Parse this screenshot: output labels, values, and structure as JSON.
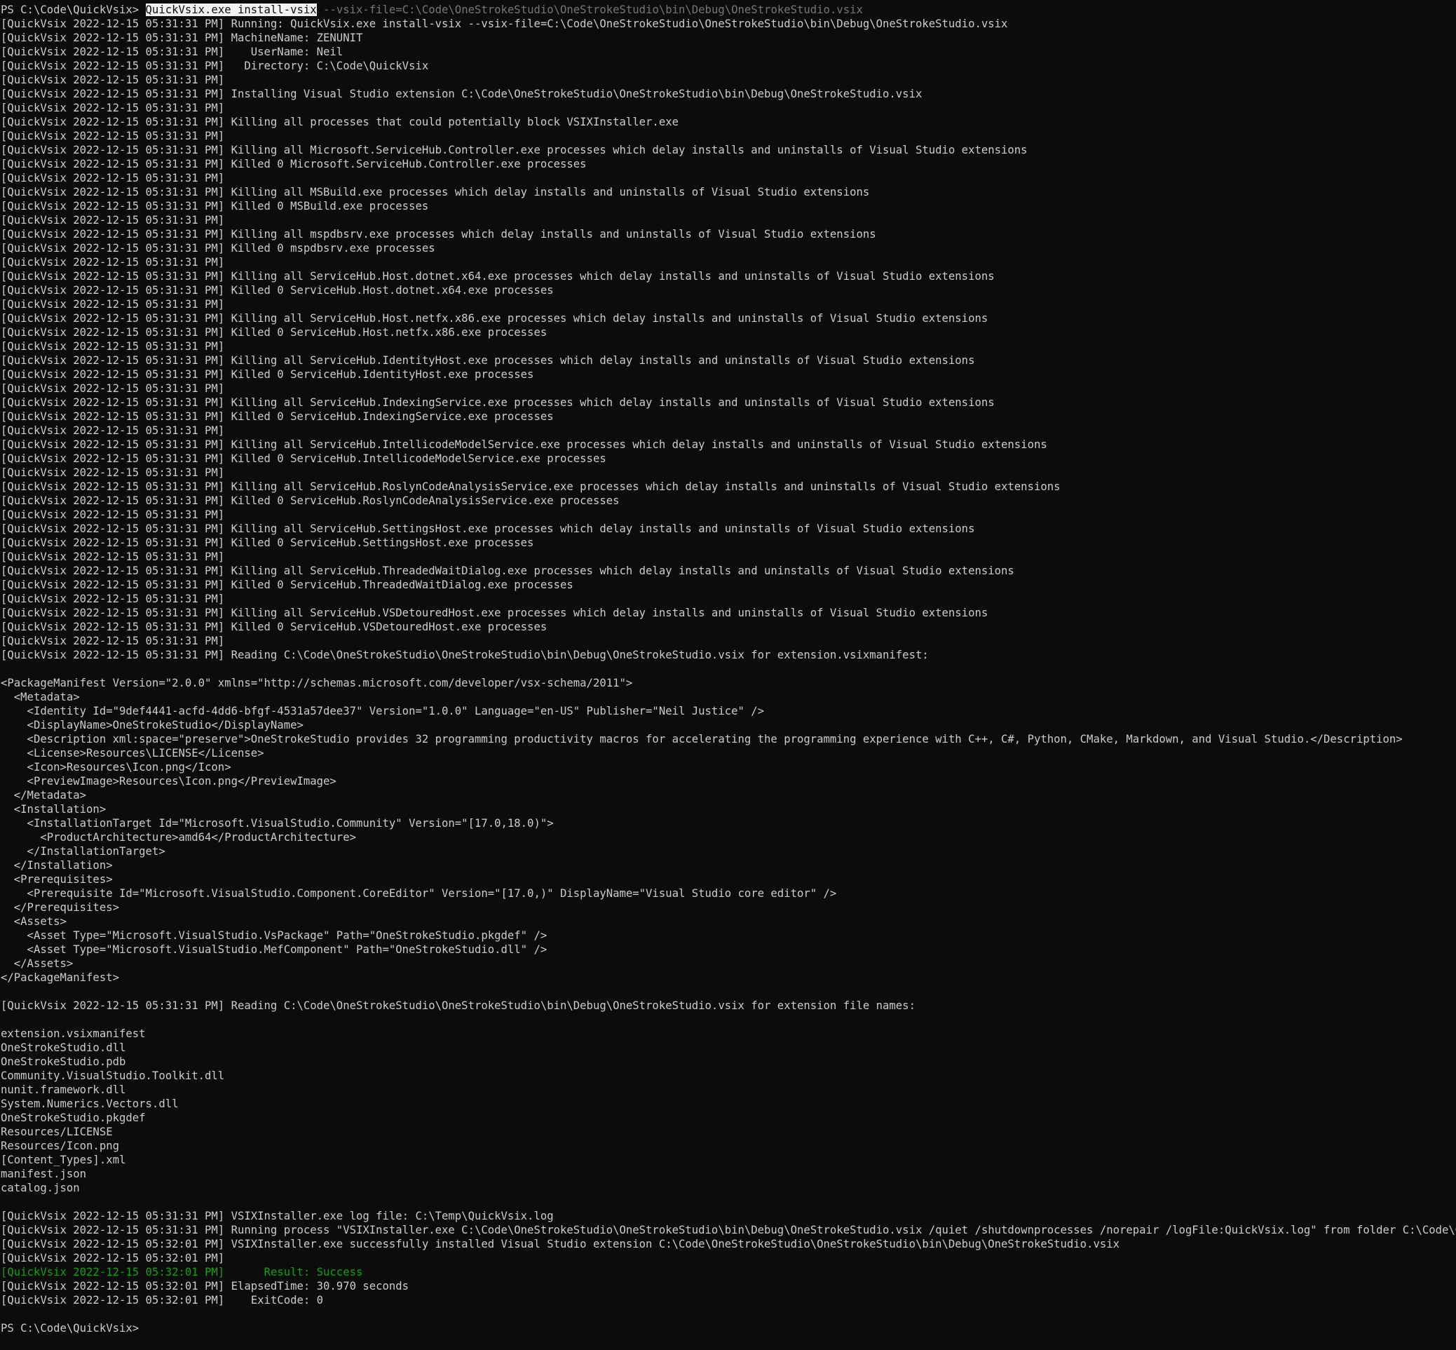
{
  "window": {
    "prompt_initial": "PS C:\\Code\\QuickVsix> ",
    "command_selected": "QuickVsix.exe install-vsix",
    "command_rest": " --vsix-file=C:\\Code\\OneStrokeStudio\\OneStrokeStudio\\bin\\Debug\\OneStrokeStudio.vsix",
    "prompt_final": "PS C:\\Code\\QuickVsix> "
  },
  "colors": {
    "background": "#0c0c0c",
    "foreground": "#cccccc",
    "selection_bg": "#f2f2f2",
    "suggestion": "#767676",
    "success": "#13a10e"
  },
  "lines": [
    {
      "text": "[QuickVsix 2022-12-15 05:31:31 PM] Running: QuickVsix.exe install-vsix --vsix-file=C:\\Code\\OneStrokeStudio\\OneStrokeStudio\\bin\\Debug\\OneStrokeStudio.vsix"
    },
    {
      "text": "[QuickVsix 2022-12-15 05:31:31 PM] MachineName: ZENUNIT"
    },
    {
      "text": "[QuickVsix 2022-12-15 05:31:31 PM]    UserName: Neil"
    },
    {
      "text": "[QuickVsix 2022-12-15 05:31:31 PM]   Directory: C:\\Code\\QuickVsix"
    },
    {
      "text": "[QuickVsix 2022-12-15 05:31:31 PM]"
    },
    {
      "text": "[QuickVsix 2022-12-15 05:31:31 PM] Installing Visual Studio extension C:\\Code\\OneStrokeStudio\\OneStrokeStudio\\bin\\Debug\\OneStrokeStudio.vsix"
    },
    {
      "text": "[QuickVsix 2022-12-15 05:31:31 PM]"
    },
    {
      "text": "[QuickVsix 2022-12-15 05:31:31 PM] Killing all processes that could potentially block VSIXInstaller.exe"
    },
    {
      "text": "[QuickVsix 2022-12-15 05:31:31 PM]"
    },
    {
      "text": "[QuickVsix 2022-12-15 05:31:31 PM] Killing all Microsoft.ServiceHub.Controller.exe processes which delay installs and uninstalls of Visual Studio extensions"
    },
    {
      "text": "[QuickVsix 2022-12-15 05:31:31 PM] Killed 0 Microsoft.ServiceHub.Controller.exe processes"
    },
    {
      "text": "[QuickVsix 2022-12-15 05:31:31 PM]"
    },
    {
      "text": "[QuickVsix 2022-12-15 05:31:31 PM] Killing all MSBuild.exe processes which delay installs and uninstalls of Visual Studio extensions"
    },
    {
      "text": "[QuickVsix 2022-12-15 05:31:31 PM] Killed 0 MSBuild.exe processes"
    },
    {
      "text": "[QuickVsix 2022-12-15 05:31:31 PM]"
    },
    {
      "text": "[QuickVsix 2022-12-15 05:31:31 PM] Killing all mspdbsrv.exe processes which delay installs and uninstalls of Visual Studio extensions"
    },
    {
      "text": "[QuickVsix 2022-12-15 05:31:31 PM] Killed 0 mspdbsrv.exe processes"
    },
    {
      "text": "[QuickVsix 2022-12-15 05:31:31 PM]"
    },
    {
      "text": "[QuickVsix 2022-12-15 05:31:31 PM] Killing all ServiceHub.Host.dotnet.x64.exe processes which delay installs and uninstalls of Visual Studio extensions"
    },
    {
      "text": "[QuickVsix 2022-12-15 05:31:31 PM] Killed 0 ServiceHub.Host.dotnet.x64.exe processes"
    },
    {
      "text": "[QuickVsix 2022-12-15 05:31:31 PM]"
    },
    {
      "text": "[QuickVsix 2022-12-15 05:31:31 PM] Killing all ServiceHub.Host.netfx.x86.exe processes which delay installs and uninstalls of Visual Studio extensions"
    },
    {
      "text": "[QuickVsix 2022-12-15 05:31:31 PM] Killed 0 ServiceHub.Host.netfx.x86.exe processes"
    },
    {
      "text": "[QuickVsix 2022-12-15 05:31:31 PM]"
    },
    {
      "text": "[QuickVsix 2022-12-15 05:31:31 PM] Killing all ServiceHub.IdentityHost.exe processes which delay installs and uninstalls of Visual Studio extensions"
    },
    {
      "text": "[QuickVsix 2022-12-15 05:31:31 PM] Killed 0 ServiceHub.IdentityHost.exe processes"
    },
    {
      "text": "[QuickVsix 2022-12-15 05:31:31 PM]"
    },
    {
      "text": "[QuickVsix 2022-12-15 05:31:31 PM] Killing all ServiceHub.IndexingService.exe processes which delay installs and uninstalls of Visual Studio extensions"
    },
    {
      "text": "[QuickVsix 2022-12-15 05:31:31 PM] Killed 0 ServiceHub.IndexingService.exe processes"
    },
    {
      "text": "[QuickVsix 2022-12-15 05:31:31 PM]"
    },
    {
      "text": "[QuickVsix 2022-12-15 05:31:31 PM] Killing all ServiceHub.IntellicodeModelService.exe processes which delay installs and uninstalls of Visual Studio extensions"
    },
    {
      "text": "[QuickVsix 2022-12-15 05:31:31 PM] Killed 0 ServiceHub.IntellicodeModelService.exe processes"
    },
    {
      "text": "[QuickVsix 2022-12-15 05:31:31 PM]"
    },
    {
      "text": "[QuickVsix 2022-12-15 05:31:31 PM] Killing all ServiceHub.RoslynCodeAnalysisService.exe processes which delay installs and uninstalls of Visual Studio extensions"
    },
    {
      "text": "[QuickVsix 2022-12-15 05:31:31 PM] Killed 0 ServiceHub.RoslynCodeAnalysisService.exe processes"
    },
    {
      "text": "[QuickVsix 2022-12-15 05:31:31 PM]"
    },
    {
      "text": "[QuickVsix 2022-12-15 05:31:31 PM] Killing all ServiceHub.SettingsHost.exe processes which delay installs and uninstalls of Visual Studio extensions"
    },
    {
      "text": "[QuickVsix 2022-12-15 05:31:31 PM] Killed 0 ServiceHub.SettingsHost.exe processes"
    },
    {
      "text": "[QuickVsix 2022-12-15 05:31:31 PM]"
    },
    {
      "text": "[QuickVsix 2022-12-15 05:31:31 PM] Killing all ServiceHub.ThreadedWaitDialog.exe processes which delay installs and uninstalls of Visual Studio extensions"
    },
    {
      "text": "[QuickVsix 2022-12-15 05:31:31 PM] Killed 0 ServiceHub.ThreadedWaitDialog.exe processes"
    },
    {
      "text": "[QuickVsix 2022-12-15 05:31:31 PM]"
    },
    {
      "text": "[QuickVsix 2022-12-15 05:31:31 PM] Killing all ServiceHub.VSDetouredHost.exe processes which delay installs and uninstalls of Visual Studio extensions"
    },
    {
      "text": "[QuickVsix 2022-12-15 05:31:31 PM] Killed 0 ServiceHub.VSDetouredHost.exe processes"
    },
    {
      "text": "[QuickVsix 2022-12-15 05:31:31 PM]"
    },
    {
      "text": "[QuickVsix 2022-12-15 05:31:31 PM] Reading C:\\Code\\OneStrokeStudio\\OneStrokeStudio\\bin\\Debug\\OneStrokeStudio.vsix for extension.vsixmanifest:"
    },
    {
      "text": ""
    },
    {
      "text": "<PackageManifest Version=\"2.0.0\" xmlns=\"http://schemas.microsoft.com/developer/vsx-schema/2011\">"
    },
    {
      "text": "  <Metadata>"
    },
    {
      "text": "    <Identity Id=\"9def4441-acfd-4dd6-bfgf-4531a57dee37\" Version=\"1.0.0\" Language=\"en-US\" Publisher=\"Neil Justice\" />"
    },
    {
      "text": "    <DisplayName>OneStrokeStudio</DisplayName>"
    },
    {
      "text": "    <Description xml:space=\"preserve\">OneStrokeStudio provides 32 programming productivity macros for accelerating the programming experience with C++, C#, Python, CMake, Markdown, and Visual Studio.</Description>"
    },
    {
      "text": "    <License>Resources\\LICENSE</License>"
    },
    {
      "text": "    <Icon>Resources\\Icon.png</Icon>"
    },
    {
      "text": "    <PreviewImage>Resources\\Icon.png</PreviewImage>"
    },
    {
      "text": "  </Metadata>"
    },
    {
      "text": "  <Installation>"
    },
    {
      "text": "    <InstallationTarget Id=\"Microsoft.VisualStudio.Community\" Version=\"[17.0,18.0)\">"
    },
    {
      "text": "      <ProductArchitecture>amd64</ProductArchitecture>"
    },
    {
      "text": "    </InstallationTarget>"
    },
    {
      "text": "  </Installation>"
    },
    {
      "text": "  <Prerequisites>"
    },
    {
      "text": "    <Prerequisite Id=\"Microsoft.VisualStudio.Component.CoreEditor\" Version=\"[17.0,)\" DisplayName=\"Visual Studio core editor\" />"
    },
    {
      "text": "  </Prerequisites>"
    },
    {
      "text": "  <Assets>"
    },
    {
      "text": "    <Asset Type=\"Microsoft.VisualStudio.VsPackage\" Path=\"OneStrokeStudio.pkgdef\" />"
    },
    {
      "text": "    <Asset Type=\"Microsoft.VisualStudio.MefComponent\" Path=\"OneStrokeStudio.dll\" />"
    },
    {
      "text": "  </Assets>"
    },
    {
      "text": "</PackageManifest>"
    },
    {
      "text": ""
    },
    {
      "text": "[QuickVsix 2022-12-15 05:31:31 PM] Reading C:\\Code\\OneStrokeStudio\\OneStrokeStudio\\bin\\Debug\\OneStrokeStudio.vsix for extension file names:"
    },
    {
      "text": ""
    },
    {
      "text": "extension.vsixmanifest"
    },
    {
      "text": "OneStrokeStudio.dll"
    },
    {
      "text": "OneStrokeStudio.pdb"
    },
    {
      "text": "Community.VisualStudio.Toolkit.dll"
    },
    {
      "text": "nunit.framework.dll"
    },
    {
      "text": "System.Numerics.Vectors.dll"
    },
    {
      "text": "OneStrokeStudio.pkgdef"
    },
    {
      "text": "Resources/LICENSE"
    },
    {
      "text": "Resources/Icon.png"
    },
    {
      "text": "[Content_Types].xml"
    },
    {
      "text": "manifest.json"
    },
    {
      "text": "catalog.json"
    },
    {
      "text": ""
    },
    {
      "text": "[QuickVsix 2022-12-15 05:31:31 PM] VSIXInstaller.exe log file: C:\\Temp\\QuickVsix.log"
    },
    {
      "text": "[QuickVsix 2022-12-15 05:31:31 PM] Running process \"VSIXInstaller.exe C:\\Code\\OneStrokeStudio\\OneStrokeStudio\\bin\\Debug\\OneStrokeStudio.vsix /quiet /shutdownprocesses /norepair /logFile:QuickVsix.log\" from folder C:\\Code\\QuickVsix"
    },
    {
      "text": "[QuickVsix 2022-12-15 05:32:01 PM] VSIXInstaller.exe successfully installed Visual Studio extension C:\\Code\\OneStrokeStudio\\OneStrokeStudio\\bin\\Debug\\OneStrokeStudio.vsix"
    },
    {
      "text": "[QuickVsix 2022-12-15 05:32:01 PM]"
    },
    {
      "text": "[QuickVsix 2022-12-15 05:32:01 PM]      Result: Success",
      "style": "green"
    },
    {
      "text": "[QuickVsix 2022-12-15 05:32:01 PM] ElapsedTime: 30.970 seconds"
    },
    {
      "text": "[QuickVsix 2022-12-15 05:32:01 PM]    ExitCode: 0"
    },
    {
      "text": ""
    }
  ]
}
